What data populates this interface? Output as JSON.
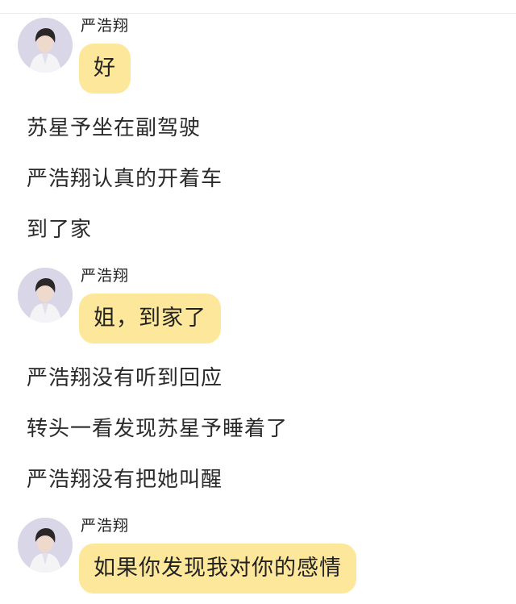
{
  "messages": [
    {
      "sender": "严浩翔",
      "text": "好"
    },
    {
      "sender": "严浩翔",
      "text": "姐，到家了"
    },
    {
      "sender": "严浩翔",
      "text": "如果你发现我对你的感情"
    }
  ],
  "narration": [
    "苏星予坐在副驾驶",
    "严浩翔认真的开着车",
    "到了家",
    "严浩翔没有听到回应",
    "转头一看发现苏星予睡着了",
    "严浩翔没有把她叫醒"
  ],
  "colors": {
    "bubble": "#fde79a",
    "avatar_bg": "#dcd8ea"
  }
}
